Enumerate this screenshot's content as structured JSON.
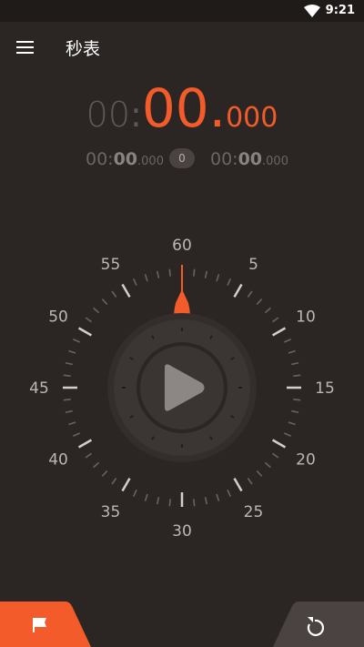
{
  "status_bar": {
    "time": "9:21",
    "wifi_icon": "wifi-icon"
  },
  "app_bar": {
    "title": "秒表",
    "menu_icon": "menu-icon"
  },
  "main_time": {
    "minutes": "00",
    "colon": ":",
    "seconds": "00",
    "dot": ".",
    "millis": "000"
  },
  "lap_left": {
    "minutes": "00:",
    "seconds": "00",
    "millis": ".000"
  },
  "lap_count": "0",
  "lap_right": {
    "minutes": "00:",
    "seconds": "00",
    "millis": ".000"
  },
  "dial": {
    "labels": [
      "60",
      "5",
      "10",
      "15",
      "20",
      "25",
      "30",
      "35",
      "40",
      "45",
      "50",
      "55"
    ],
    "play_icon": "play-icon"
  },
  "bottom": {
    "lap_icon": "flag-icon",
    "reset_icon": "reset-icon"
  },
  "colors": {
    "accent": "#f45b2a",
    "background": "#2b2624",
    "dial": "#3a3432"
  }
}
